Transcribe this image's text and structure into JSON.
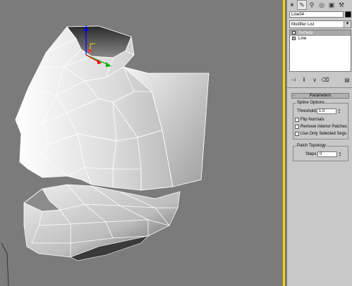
{
  "object": {
    "name": "Line04",
    "color": "#000000"
  },
  "modifier_list": {
    "label": "Modifier List"
  },
  "stack": [
    {
      "label": "Surface",
      "selected": true
    },
    {
      "label": "Line",
      "selected": false
    }
  ],
  "parameters": {
    "title": "Parameters",
    "spline_options": {
      "title": "Spline Options",
      "threshold_label": "Threshold:",
      "threshold_value": "1.0",
      "flip_normals": "Flip Normals",
      "remove_interior": "Remove Interior Patches",
      "use_only_selected": "Use Only Selected Segs."
    },
    "patch_topology": {
      "title": "Patch Topology",
      "steps_label": "Steps:",
      "steps_value": "0"
    }
  },
  "tabs": [
    "create-icon",
    "modify-icon",
    "hierarchy-icon",
    "motion-icon",
    "display-icon",
    "utilities-icon"
  ],
  "colors": {
    "viewport_bg": "#7b7b7b",
    "active_border": "#f2d600",
    "panel_bg": "#c8c8c8"
  }
}
